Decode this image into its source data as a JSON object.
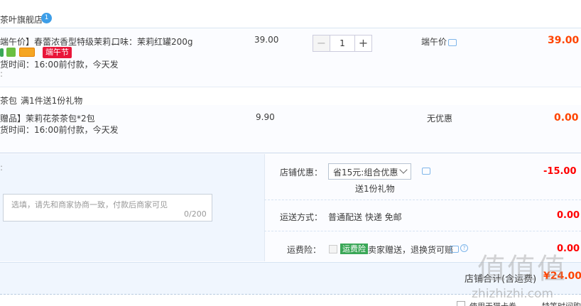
{
  "shop": {
    "name": "茶叶旗舰店",
    "badge": "1"
  },
  "item1": {
    "title": "端午价】春蕾浓香型特级茉莉…",
    "spec": "口味：茉莉红罐200g",
    "festival_tag": "端午节",
    "delivery": "货时间：16:00前付款，今天发",
    "unit_price": "39.00",
    "quantity": "1",
    "discount_label": "端午价",
    "subtotal": "39.00"
  },
  "promo": {
    "prefix": "茶包",
    "text": "满1件送1份礼物"
  },
  "item2": {
    "title": "赠品】茉莉花茶茶包*2包",
    "delivery": "货时间：16:00前付款，今天发",
    "unit_price": "9.90",
    "discount_label": "无优惠",
    "subtotal": "0.00"
  },
  "message": {
    "placeholder": "选填，请先和商家协商一致，付款后商家可见",
    "counter": "0/200"
  },
  "shop_discount": {
    "label": "店铺优惠：",
    "selected": "省15元:组合优惠",
    "gift_note": "送1份礼物",
    "amount": "-15.00"
  },
  "shipping": {
    "label": "运送方式：",
    "text": "普通配送 快递 免邮",
    "amount": "0.00"
  },
  "insurance": {
    "label": "运费险：",
    "tag": "运费险",
    "text": "卖家赠送，退换货可赔",
    "amount": "0.00"
  },
  "total": {
    "label": "店铺合计(含运费)",
    "amount": "¥24.00"
  },
  "footer": {
    "check_label": "使用天猫卡券",
    "right_text": "特等时间购买"
  },
  "watermark": {
    "text": "值值值",
    "url": "zhizhizhi.com"
  },
  "colors": {
    "price": "#ff4400",
    "discount": "#ff0000",
    "accent_blue": "#3d9ee8",
    "festival_red": "#e9173a"
  }
}
